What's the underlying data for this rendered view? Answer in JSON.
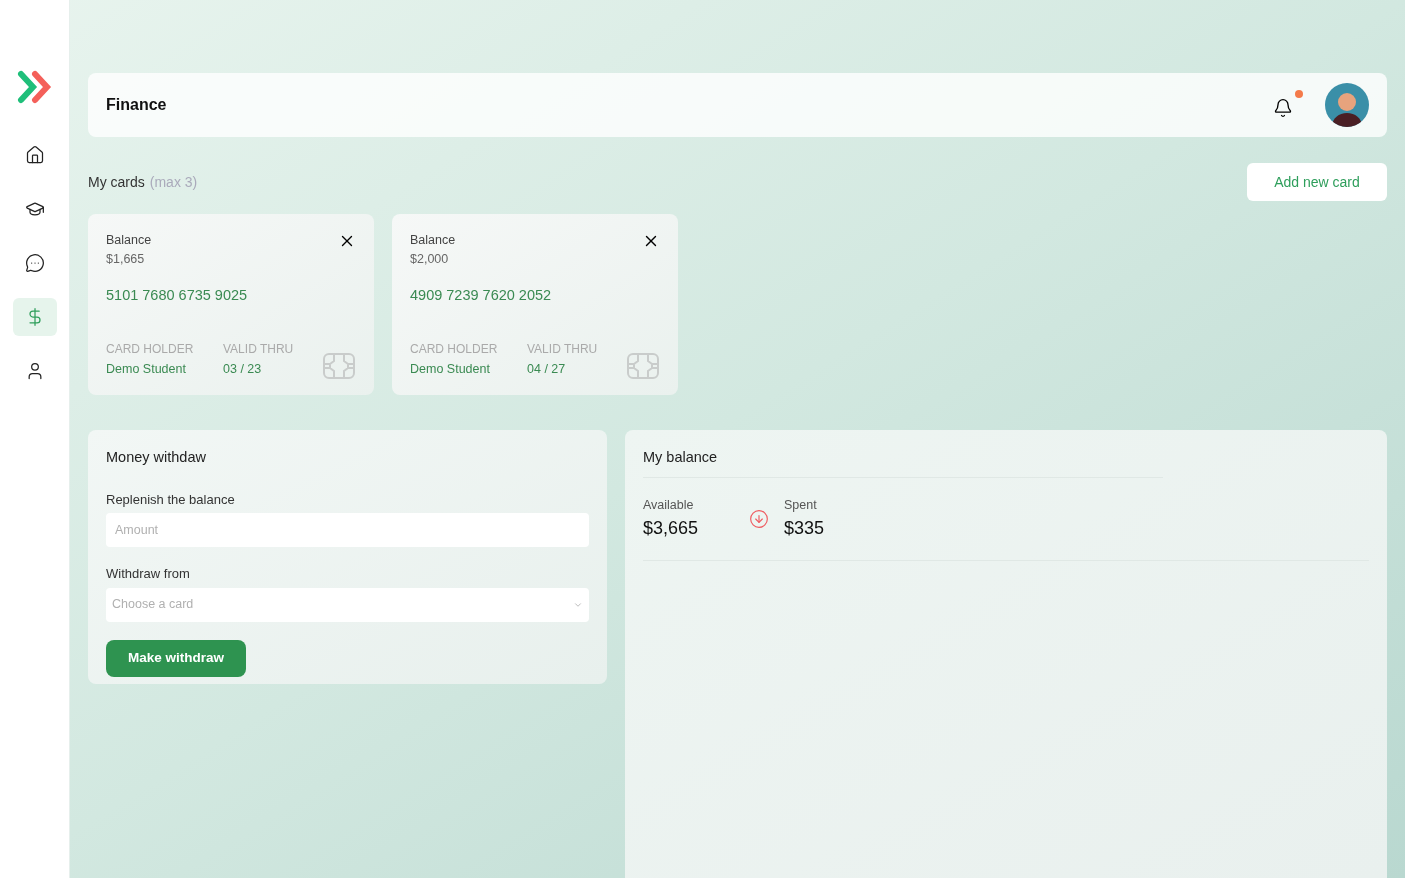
{
  "sidebar": {
    "items": [
      {
        "kind": "home",
        "selected": false
      },
      {
        "kind": "courses",
        "selected": false
      },
      {
        "kind": "messages",
        "selected": false
      },
      {
        "kind": "finance",
        "selected": true
      },
      {
        "kind": "profile",
        "selected": false
      }
    ]
  },
  "header": {
    "title": "Finance",
    "has_notification": true
  },
  "cards_section": {
    "title": "My cards",
    "hint": "(max 3)",
    "add_button": "Add new card"
  },
  "cards": [
    {
      "balance_label": "Balance",
      "balance": "$1,665",
      "number": "5101 7680 6735 9025",
      "holder_label": "CARD HOLDER",
      "holder": "Demo Student",
      "valid_label": "VALID THRU",
      "valid": "03 / 23"
    },
    {
      "balance_label": "Balance",
      "balance": "$2,000",
      "number": "4909 7239 7620 2052",
      "holder_label": "CARD HOLDER",
      "holder": "Demo Student",
      "valid_label": "VALID THRU",
      "valid": "04 / 27"
    }
  ],
  "withdraw": {
    "title": "Money withdaw",
    "amount_label": "Replenish the balance",
    "amount_placeholder": "Amount",
    "from_label": "Withdraw from",
    "from_placeholder": "Choose a card",
    "button": "Make withdraw"
  },
  "balance": {
    "title": "My balance",
    "available_label": "Available",
    "available": "$3,665",
    "spent_label": "Spent",
    "spent": "$335"
  }
}
